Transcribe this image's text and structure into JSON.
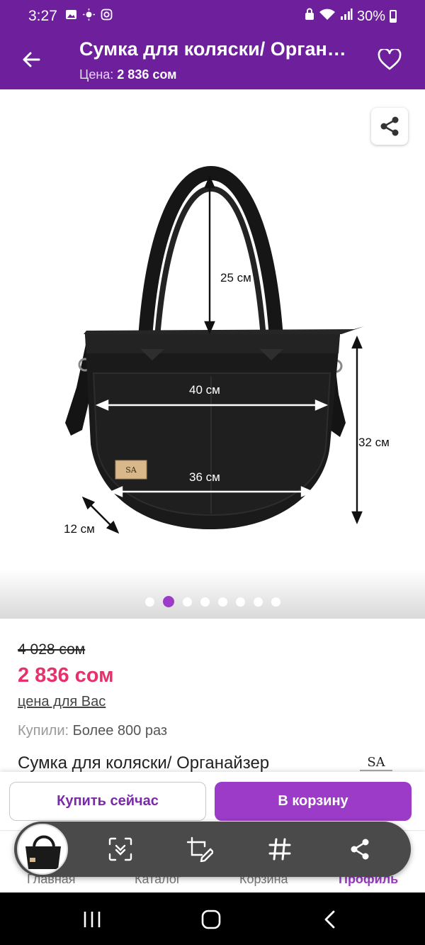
{
  "status_bar": {
    "time": "3:27",
    "battery": "30%"
  },
  "app_bar": {
    "title": "Сумка для коляски/ Органайзер",
    "price_label": "Цена:",
    "price_value": "2 836 сом"
  },
  "gallery": {
    "dimension_labels": [
      "25 см",
      "40 см",
      "36 см",
      "32 см",
      "12 см"
    ],
    "dots_count": 8,
    "active_dot": 1,
    "brand_tag": "SA"
  },
  "product": {
    "old_price": "4 028 сом",
    "new_price": "2 836 сом",
    "price_note": "цена для Вас",
    "bought_label": "Купили:",
    "bought_value": "Более 800 раз",
    "name": "Сумка для коляски/ Органайзер",
    "brand_logo_text": "SA"
  },
  "actions": {
    "buy_now": "Купить сейчас",
    "add_to_cart": "В корзину"
  },
  "bottom_nav": [
    "Главная",
    "Каталог",
    "Корзина",
    "Профиль"
  ],
  "colors": {
    "brand": "#6d1f9c",
    "accent": "#9b3bc7",
    "sale": "#e8306b"
  }
}
